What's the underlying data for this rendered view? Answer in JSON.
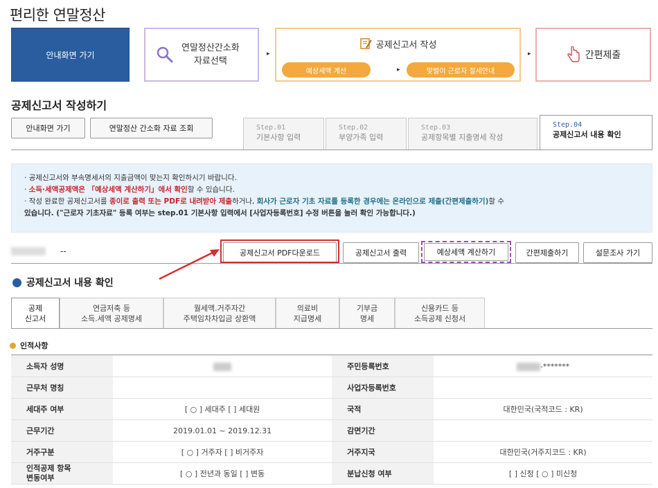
{
  "app": {
    "title": "편리한 연말정산"
  },
  "flow": {
    "home": "안내화면 가기",
    "step1": {
      "line1": "연말정산간소화",
      "line2": "자료선택"
    },
    "step2": {
      "title": "공제신고서 작성",
      "sub1": "예상세액 계산",
      "sub2": "맞벌이 근로자 절세안내"
    },
    "step3": "간편제출",
    "arrow": "▸"
  },
  "section": {
    "title": "공제신고서 작성하기"
  },
  "nav_buttons": {
    "home": "안내화면 가기",
    "lookup": "연말정산 간소화 자료 조회"
  },
  "steps": [
    {
      "label": "Step.01",
      "name": "기본사항 입력"
    },
    {
      "label": "Step.02",
      "name": "부양가족 입력"
    },
    {
      "label": "Step.03",
      "name": "공제항목별 지출명세 작성"
    },
    {
      "label": "Step.04",
      "name": "공제신고서 내용 확인"
    }
  ],
  "notice": {
    "line1": "공제신고서와 부속명세서의 지출금액이 맞는지 확인하시기 바랍니다.",
    "line2_red": "소득·세액공제액은 「예상세액 계산하기」에서 확인",
    "line2_rest": "할 수 있습니다.",
    "line3_a": "작성 완료한 공제신고서를 ",
    "line3_red": "종이로 출력 또는 PDF로 내려받아 제출",
    "line3_b": "하거나, ",
    "line3_teal": "회사가 근로자 기초 자료를 등록한 경우에는 온라인으로 제출(간편제출하기)",
    "line3_c": "할 수",
    "line4": "있습니다. (\"근로자 기초자료\" 등록 여부는 step.01 기본사항 입력에서 [사업자등록번호] 수정 버튼을 눌러 확인 가능합니다.)"
  },
  "user": {
    "dashes": "--"
  },
  "actions": {
    "pdf": "공제신고서 PDF다운로드",
    "print": "공제신고서 출력",
    "estimate": "예상세액 계산하기",
    "submit": "간편제출하기",
    "survey": "설문조사 가기"
  },
  "confirm": {
    "title": "공제신고서 내용 확인"
  },
  "detail_tabs": [
    {
      "l1": "공제",
      "l2": "신고서"
    },
    {
      "l1": "연금저축 등",
      "l2": "소득.세액 공제명세"
    },
    {
      "l1": "월세액.거주자간",
      "l2": "주택임차차입금 상환액"
    },
    {
      "l1": "의료비",
      "l2": "지급명세"
    },
    {
      "l1": "기부금",
      "l2": "명세"
    },
    {
      "l1": "신용카드 등",
      "l2": "소득공제 신청서"
    }
  ],
  "personal": {
    "title": "인적사항",
    "rows": [
      {
        "h1": "소득자 성명",
        "v1": "",
        "h2": "주민등록번호",
        "v2": "-*******"
      },
      {
        "h1": "근무처 명칭",
        "v1": "",
        "h2": "사업자등록번호",
        "v2": ""
      },
      {
        "h1": "세대주 여부",
        "v1": "[ ○ ] 세대주  [   ] 세대원",
        "h2": "국적",
        "v2": "대한민국(국적코드 : KR)"
      },
      {
        "h1": "근무기간",
        "v1": "2019.01.01 ~ 2019.12.31",
        "h2": "감면기간",
        "v2": ""
      },
      {
        "h1": "거주구분",
        "v1": "[ ○ ] 거주자  [   ] 비거주자",
        "h2": "거주지국",
        "v2": "대한민국(거주지코드 : KR)"
      },
      {
        "h1a": "인적공제 항목",
        "h1b": "변동여부",
        "v1": "[ ○ ] 전년과 동일  [   ] 변동",
        "h2": "분납신청 여부",
        "v2": "[   ] 신청 [ ○ ] 미신청"
      }
    ]
  },
  "colors": {
    "primary": "#2a5d9f",
    "orange": "#f5a83d",
    "highlight_red": "#d32f2f",
    "highlight_purple": "#9c4fb2"
  }
}
